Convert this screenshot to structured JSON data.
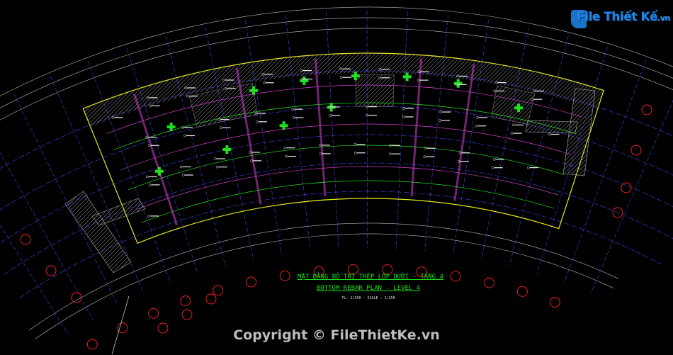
{
  "drawing": {
    "title_vn": "MẶT BẰNG BỐ TRÍ THÉP LỚP DƯỚI - TẦNG 4",
    "title_en": "BOTTOM REBAR PLAN - LEVEL 4",
    "scale": "TL: 1/250 - SCALE : 1/250"
  },
  "watermark": {
    "logo_main": "File Thiết Kế",
    "logo_ext": ".vn",
    "copyright": "Copyright © FileThietKe.vn"
  },
  "colors": {
    "background": "#000000",
    "grid_line": "#3a3ad0",
    "slab_edge": "#e8e820",
    "rebar_magenta": "#d040d0",
    "column_green": "#20e020",
    "grid_bubble": "#ff2020",
    "hatch": "#9a9a9a",
    "title_green": "#18e018",
    "logo_blue": "#1e86e6"
  },
  "icons": [
    "grid-bubble-icon",
    "column-marker-icon",
    "north-arrow-icon"
  ]
}
